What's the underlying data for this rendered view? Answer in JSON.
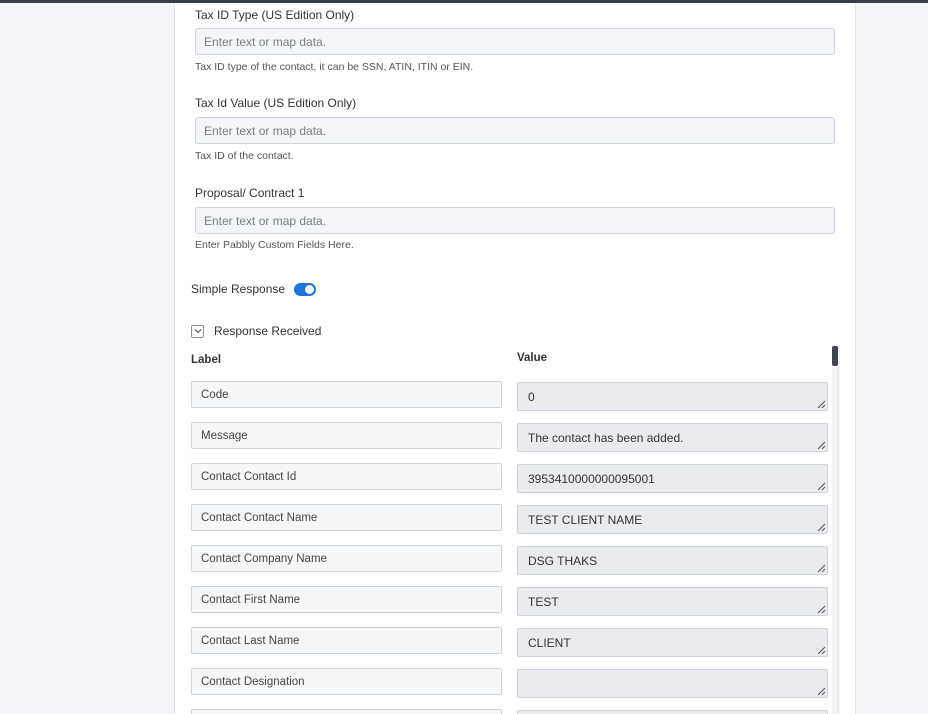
{
  "form": {
    "fields": [
      {
        "label": "Tax ID Type (US Edition Only)",
        "placeholder": "Enter text or map data.",
        "help": "Tax ID type of the contact, it can be SSN, ATIN, ITIN or EIN."
      },
      {
        "label": "Tax Id Value (US Edition Only)",
        "placeholder": "Enter text or map data.",
        "help": "Tax ID of the contact."
      },
      {
        "label": "Proposal/ Contract 1",
        "placeholder": "Enter text or map data.",
        "help": "Enter Pabbly Custom Fields Here."
      }
    ],
    "simple_response": {
      "label": "Simple Response",
      "enabled": true
    }
  },
  "response": {
    "title": "Response Received",
    "col_label": "Label",
    "col_value": "Value",
    "rows": [
      {
        "label": "Code",
        "value": "0"
      },
      {
        "label": "Message",
        "value": "The contact has been added."
      },
      {
        "label": "Contact Contact Id",
        "value": "3953410000000095001"
      },
      {
        "label": "Contact Contact Name",
        "value": "TEST CLIENT NAME"
      },
      {
        "label": "Contact Company Name",
        "value": "DSG THAKS"
      },
      {
        "label": "Contact First Name",
        "value": "TEST"
      },
      {
        "label": "Contact Last Name",
        "value": "CLIENT"
      },
      {
        "label": "Contact Designation",
        "value": ""
      }
    ]
  },
  "icons": {
    "chevron": "chevron-down-icon",
    "resize": "resize-grip-icon"
  },
  "colors": {
    "accent": "#1d74d8",
    "input_bg": "#f3f5f8",
    "value_bg": "#e9ebee",
    "page_bg": "#f3f5f8"
  }
}
